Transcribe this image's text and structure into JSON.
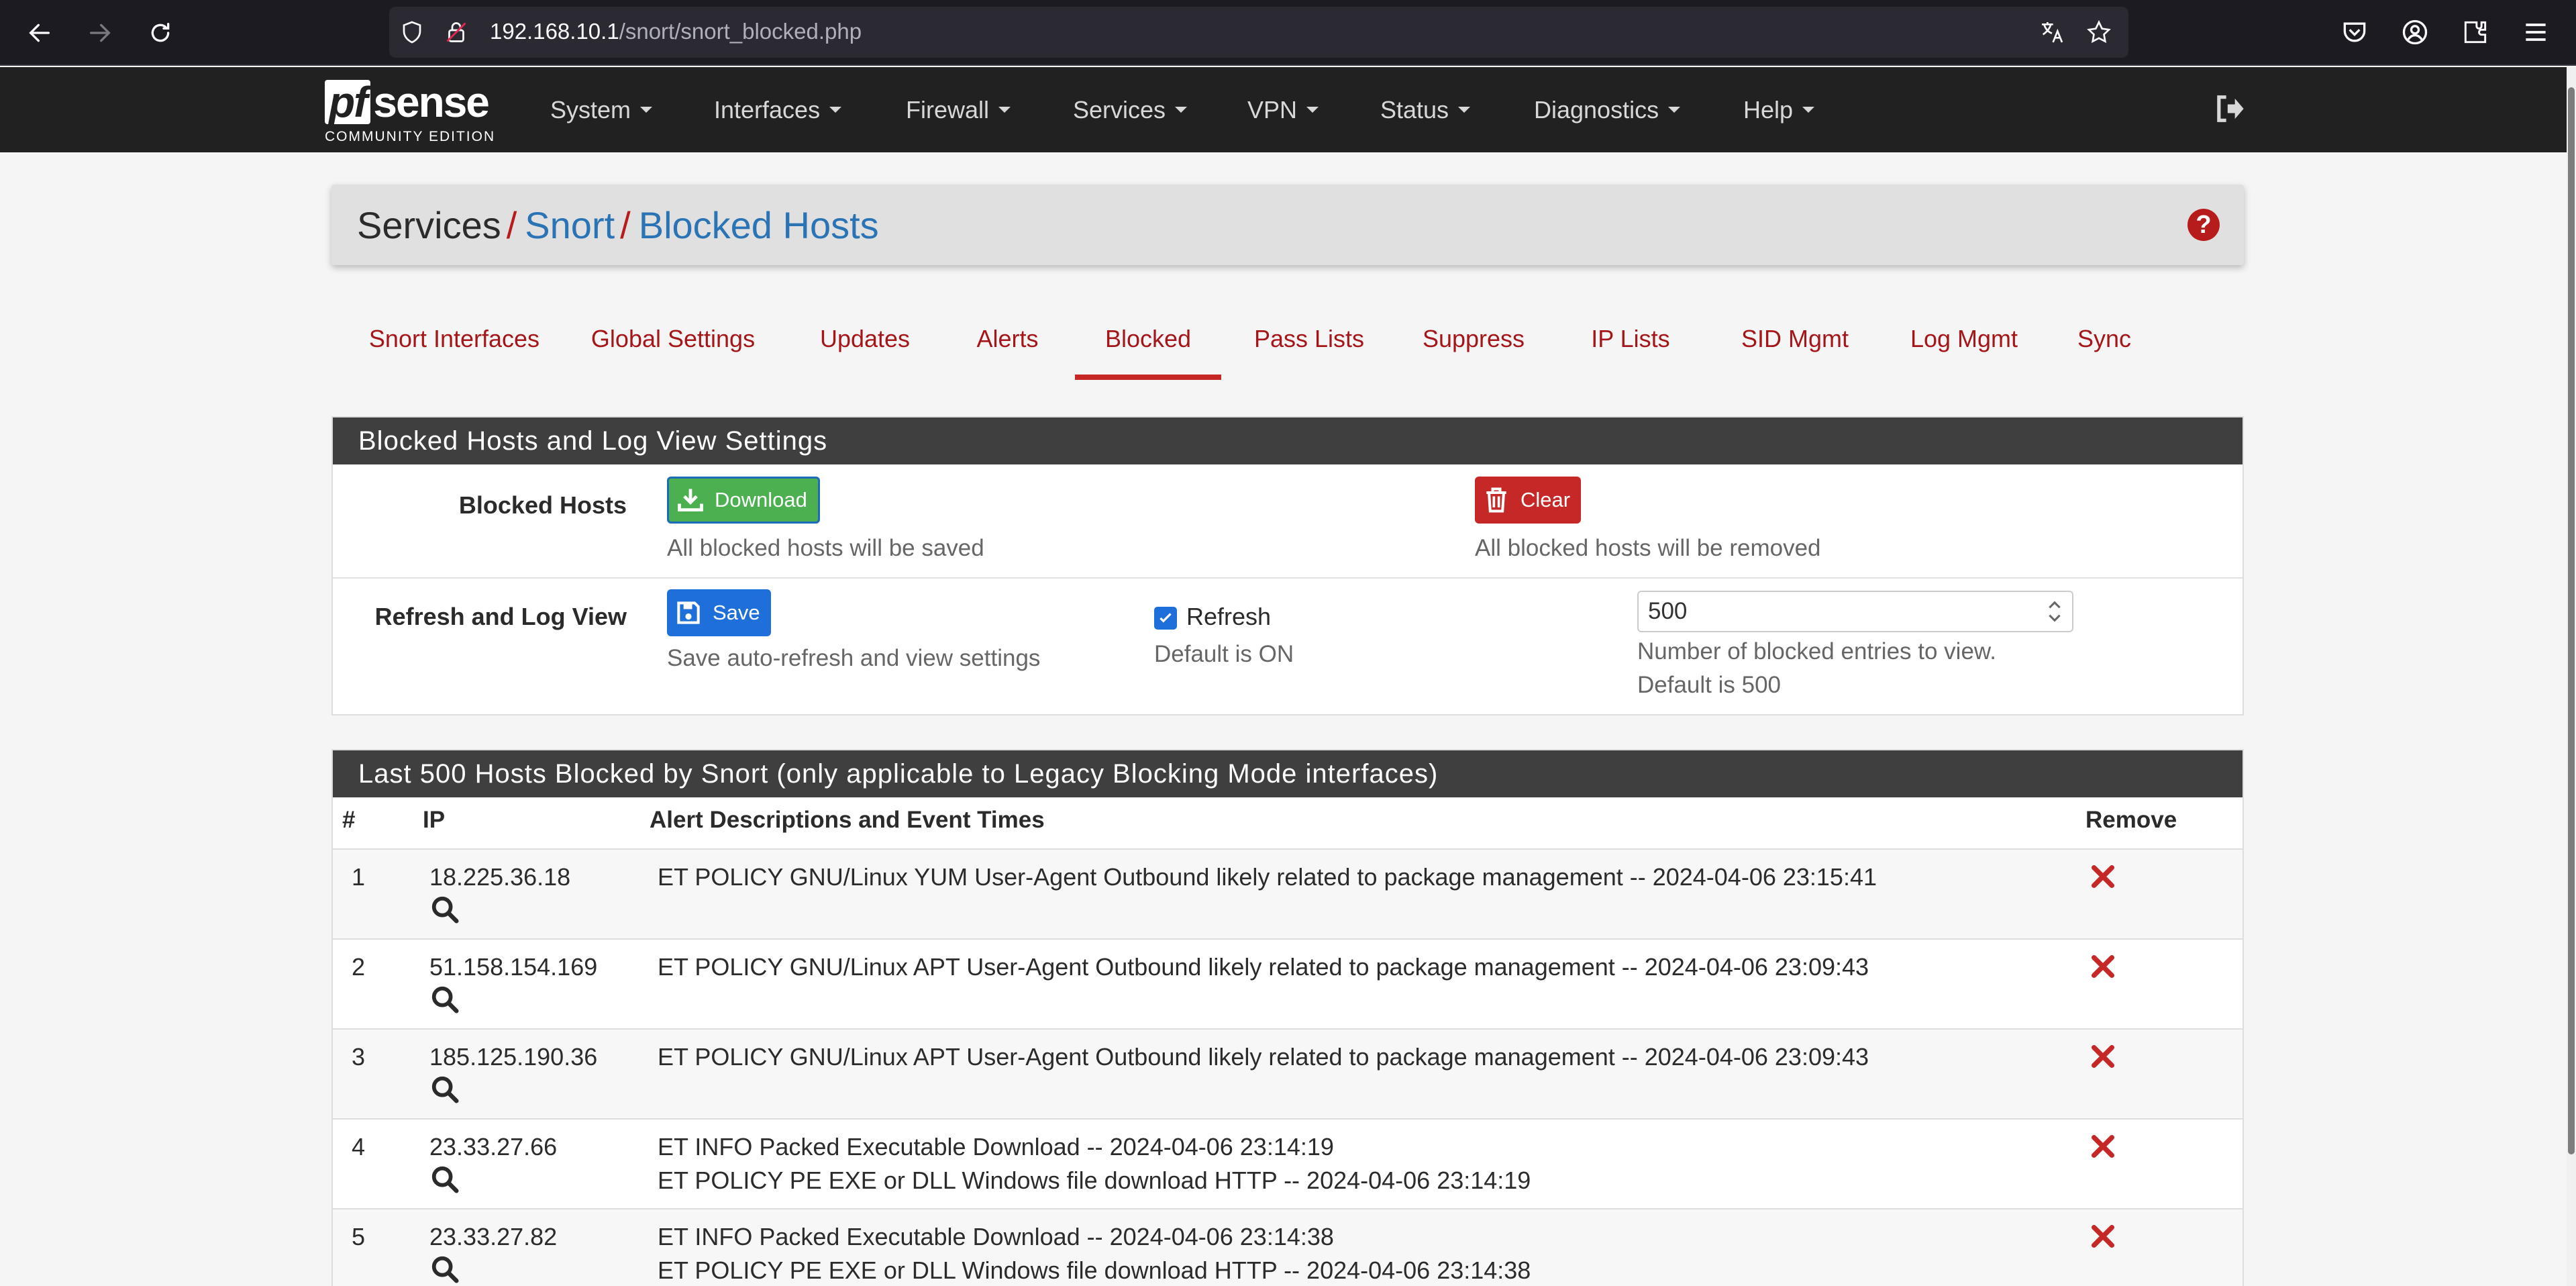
{
  "browser": {
    "url_host": "192.168.10.1",
    "url_path": "/snort/snort_blocked.php"
  },
  "pfsense": {
    "logo_word": "sense",
    "logo_pf": "pf",
    "edition": "COMMUNITY EDITION",
    "menu": [
      "System",
      "Interfaces",
      "Firewall",
      "Services",
      "VPN",
      "Status",
      "Diagnostics",
      "Help"
    ]
  },
  "breadcrumb": {
    "root": "Services",
    "sep": "/",
    "level1": "Snort",
    "level2": "Blocked Hosts"
  },
  "tabs": [
    "Snort Interfaces",
    "Global Settings",
    "Updates",
    "Alerts",
    "Blocked",
    "Pass Lists",
    "Suppress",
    "IP Lists",
    "SID Mgmt",
    "Log Mgmt",
    "Sync"
  ],
  "active_tab": "Blocked",
  "settings_panel": {
    "title": "Blocked Hosts and Log View Settings",
    "blocked_hosts_label": "Blocked Hosts",
    "download_label": "Download",
    "download_help": "All blocked hosts will be saved",
    "clear_label": "Clear",
    "clear_help": "All blocked hosts will be removed",
    "refresh_row_label": "Refresh and Log View",
    "save_label": "Save",
    "save_help": "Save auto-refresh and view settings",
    "refresh_label": "Refresh",
    "refresh_checked": true,
    "refresh_help": "Default is ON",
    "entries_value": "500",
    "entries_help_1": "Number of blocked entries to view.",
    "entries_help_2": "Default is 500"
  },
  "blocked_table": {
    "title": "Last 500 Hosts Blocked by Snort (only applicable to Legacy Blocking Mode interfaces)",
    "headers": {
      "num": "#",
      "ip": "IP",
      "desc": "Alert Descriptions and Event Times",
      "remove": "Remove"
    },
    "rows": [
      {
        "num": "1",
        "ip": "18.225.36.18",
        "desc": [
          "ET POLICY GNU/Linux YUM User-Agent Outbound likely related to package management -- 2024-04-06 23:15:41"
        ]
      },
      {
        "num": "2",
        "ip": "51.158.154.169",
        "desc": [
          "ET POLICY GNU/Linux APT User-Agent Outbound likely related to package management -- 2024-04-06 23:09:43"
        ]
      },
      {
        "num": "3",
        "ip": "185.125.190.36",
        "desc": [
          "ET POLICY GNU/Linux APT User-Agent Outbound likely related to package management -- 2024-04-06 23:09:43"
        ]
      },
      {
        "num": "4",
        "ip": "23.33.27.66",
        "desc": [
          "ET INFO Packed Executable Download -- 2024-04-06 23:14:19",
          "ET POLICY PE EXE or DLL Windows file download HTTP -- 2024-04-06 23:14:19"
        ]
      },
      {
        "num": "5",
        "ip": "23.33.27.82",
        "desc": [
          "ET INFO Packed Executable Download -- 2024-04-06 23:14:38",
          "ET POLICY PE EXE or DLL Windows file download HTTP -- 2024-04-06 23:14:38"
        ]
      }
    ]
  },
  "colors": {
    "nav_bg": "#212121",
    "accent_red": "#c62828",
    "link_blue": "#2a73b5",
    "panel_heading": "#3f3f3f",
    "download_green": "#4caf50",
    "save_blue": "#1e6fd9"
  },
  "icons": [
    "back-arrow-icon",
    "forward-arrow-icon",
    "reload-icon",
    "shield-icon",
    "lock-icon",
    "translate-icon",
    "star-icon",
    "pocket-icon",
    "account-icon",
    "extensions-icon",
    "menu-icon",
    "logout-icon",
    "help-icon",
    "download-icon",
    "trash-icon",
    "save-icon",
    "search-icon",
    "remove-icon"
  ]
}
